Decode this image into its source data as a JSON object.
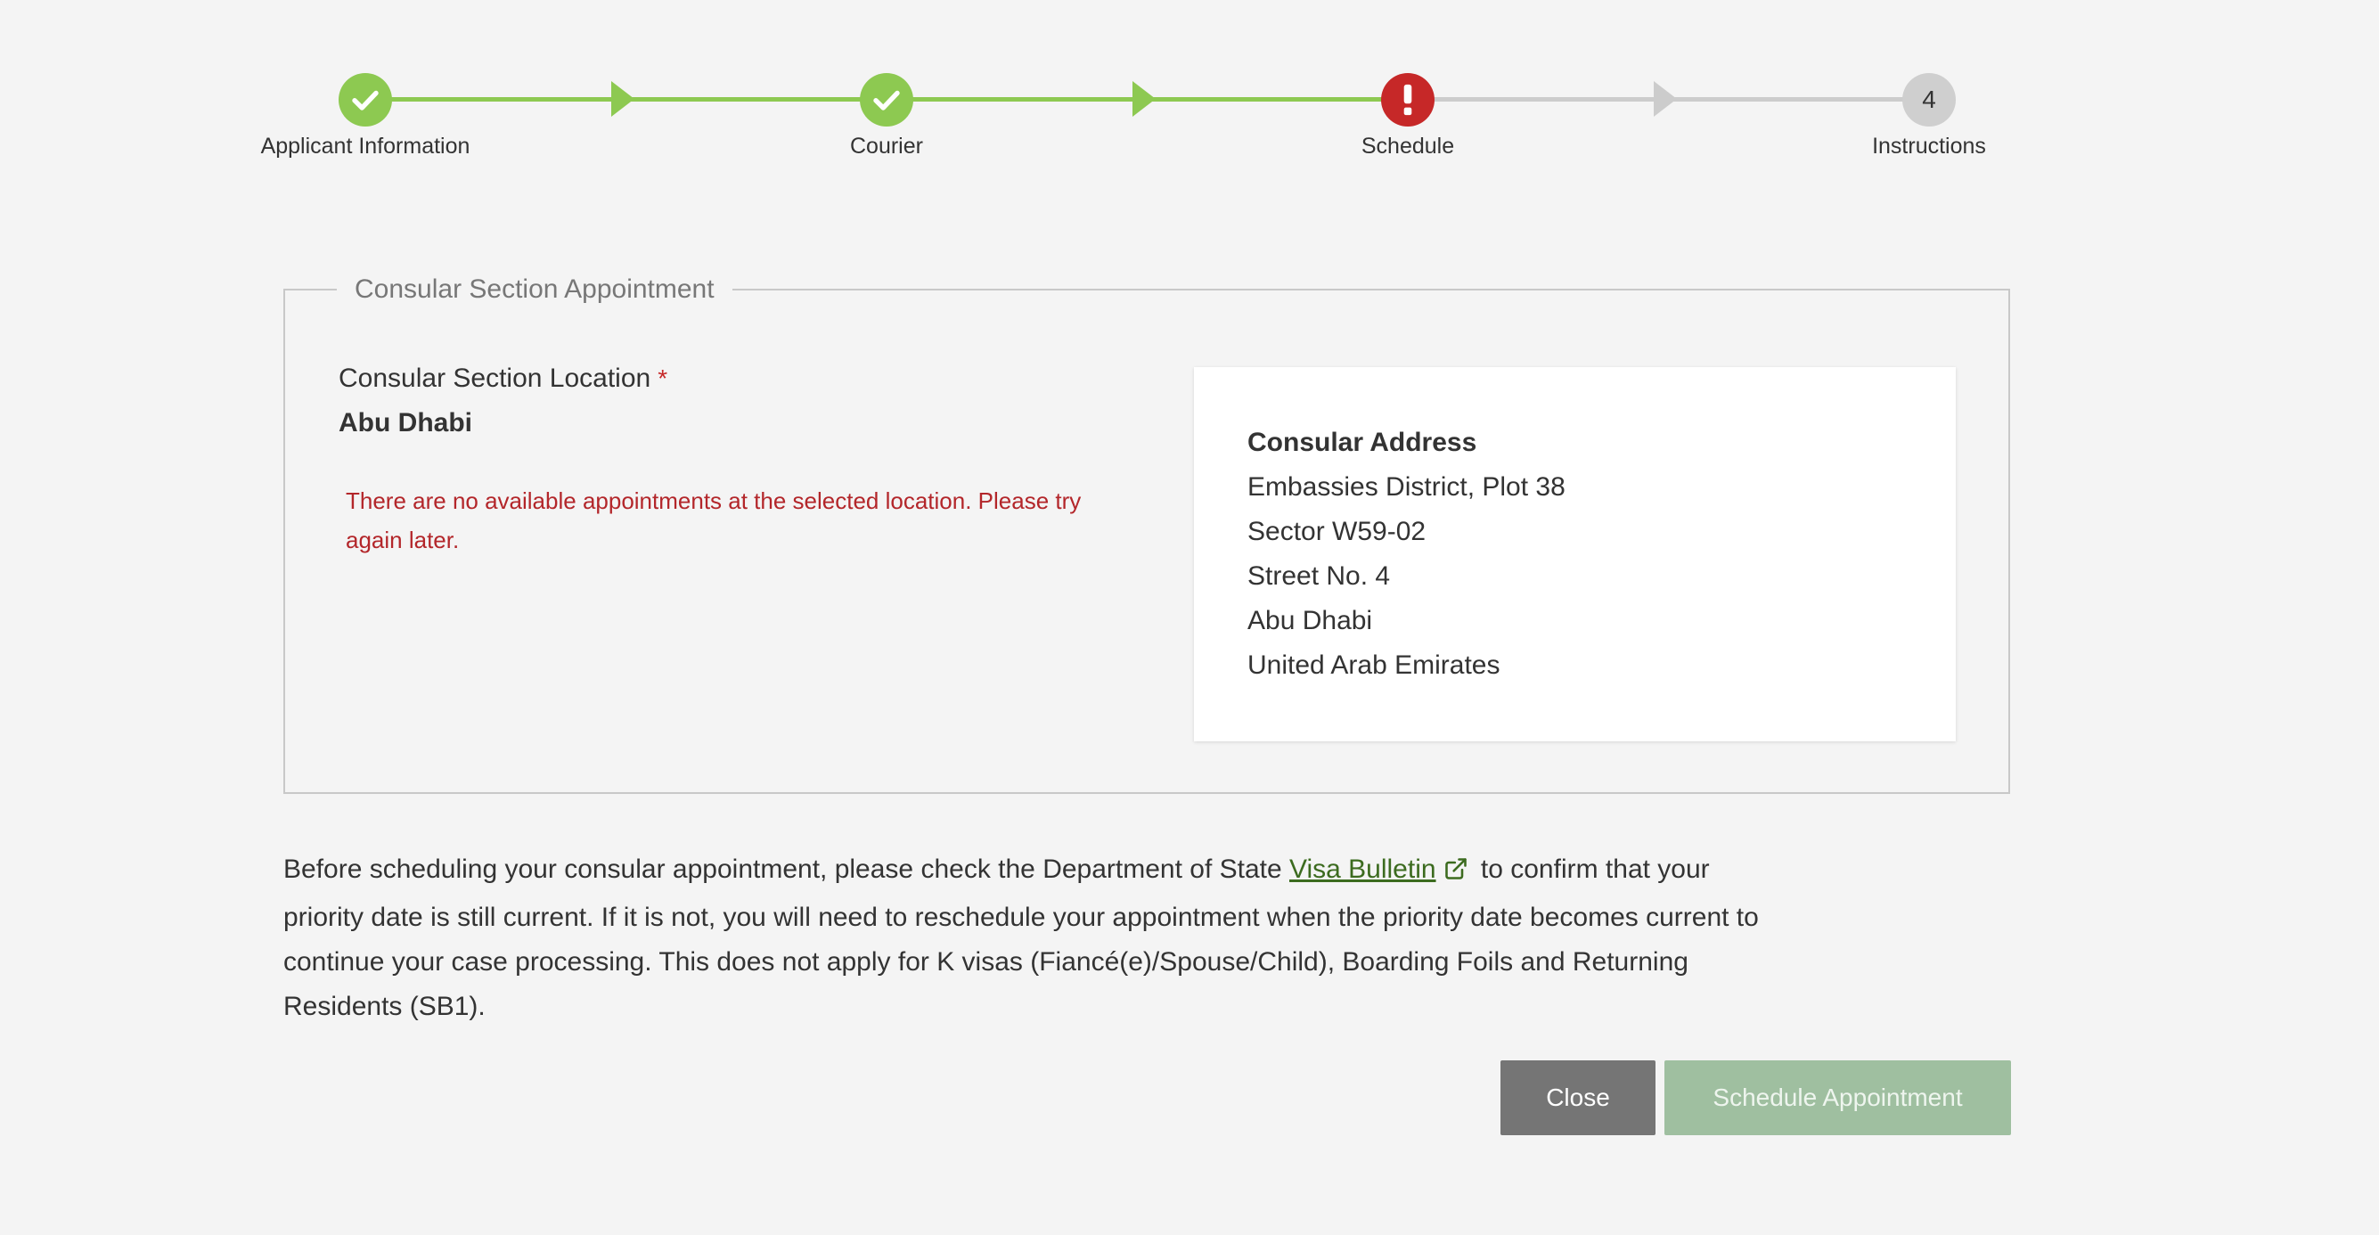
{
  "stepper": {
    "steps": [
      {
        "label": "Applicant Information",
        "status": "done"
      },
      {
        "label": "Courier",
        "status": "done"
      },
      {
        "label": "Schedule",
        "status": "error"
      },
      {
        "label": "Instructions",
        "status": "pending",
        "number": "4"
      }
    ]
  },
  "appointment": {
    "legend": "Consular Section Appointment",
    "location_label": "Consular Section Location",
    "required_marker": "*",
    "location_value": "Abu Dhabi",
    "error_message": "There are no available appointments at the selected location. Please try again later.",
    "address": {
      "title": "Consular Address",
      "lines": [
        "Embassies District, Plot 38",
        "Sector W59-02",
        "Street No. 4",
        "Abu Dhabi",
        "United Arab Emirates"
      ]
    }
  },
  "notice": {
    "before_link": "Before scheduling your consular appointment, please check the Department of State ",
    "link_text": "Visa Bulletin",
    "after_link": " to confirm that your priority date is still current. If it is not, you will need to reschedule your appointment when the priority date becomes current to continue your case processing. This does not apply for K visas (Fiancé(e)/Spouse/Child), Boarding Foils and Returning Residents (SB1)."
  },
  "buttons": {
    "close_label": "Close",
    "schedule_label": "Schedule Appointment"
  },
  "colors": {
    "step_done": "#8dc951",
    "step_error": "#c62828",
    "step_pending": "#cfcfcf",
    "link": "#3c6b1f",
    "error_text": "#b3262a"
  }
}
